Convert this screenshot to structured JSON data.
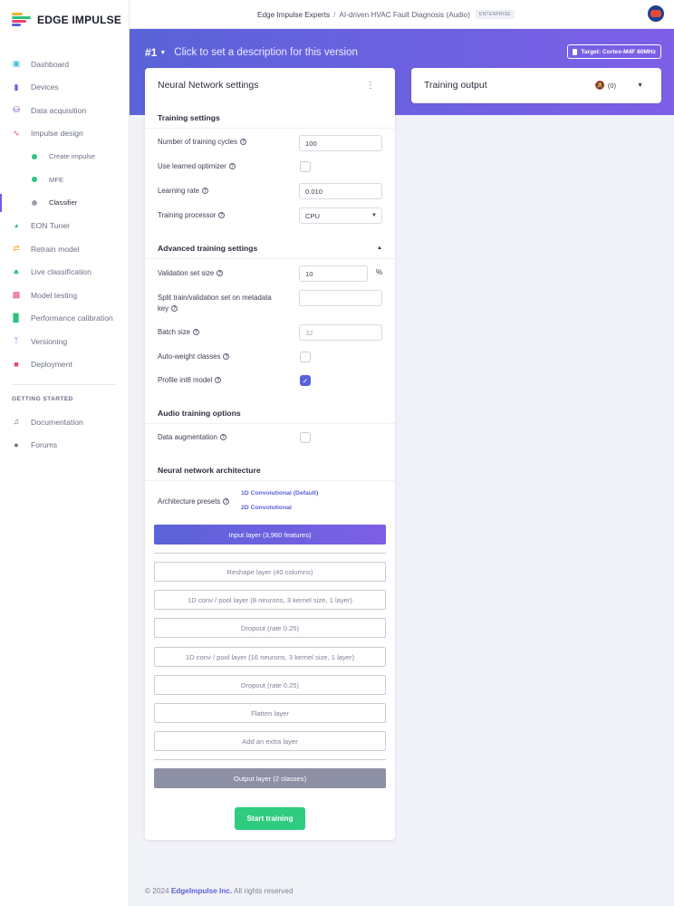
{
  "brand": {
    "name": "EDGE IMPULSE",
    "colors": [
      "#f2b134",
      "#2ec27e",
      "#e4466b",
      "#5b62d9"
    ]
  },
  "sidebar": {
    "items": [
      {
        "label": "Dashboard",
        "icon": "monitor-icon",
        "color": "#3ec0d9"
      },
      {
        "label": "Devices",
        "icon": "device-icon",
        "color": "#6d5ee8"
      },
      {
        "label": "Data acquisition",
        "icon": "database-icon",
        "color": "#7b3fbf"
      },
      {
        "label": "Impulse design",
        "icon": "pulse-icon",
        "color": "#e4466b"
      }
    ],
    "subitems": [
      {
        "label": "Create impulse"
      },
      {
        "label": "MFE"
      },
      {
        "label": "Classifier"
      }
    ],
    "items2": [
      {
        "label": "EON Tuner",
        "icon": "tuner-icon",
        "color": "#2ec27e"
      },
      {
        "label": "Retrain model",
        "icon": "shuffle-icon",
        "color": "#f2b134"
      },
      {
        "label": "Live classification",
        "icon": "live-icon",
        "color": "#2ec27e"
      },
      {
        "label": "Model testing",
        "icon": "testing-icon",
        "color": "#e4466b"
      },
      {
        "label": "Performance calibration",
        "icon": "chart-icon",
        "color": "#2ec27e"
      },
      {
        "label": "Versioning",
        "icon": "branch-icon",
        "color": "#5b62d9"
      },
      {
        "label": "Deployment",
        "icon": "package-icon",
        "color": "#e4466b"
      }
    ],
    "group_label": "GETTING STARTED",
    "help_items": [
      {
        "label": "Documentation",
        "icon": "book-icon"
      },
      {
        "label": "Forums",
        "icon": "chat-icon"
      }
    ]
  },
  "topbar": {
    "org": "Edge Impulse Experts",
    "separator": "/",
    "project": "AI-driven HVAC Fault Diagnosis (Audio)",
    "badge": "ENTERPRISE"
  },
  "banner": {
    "version": "#1",
    "description": "Click to set a description for this version",
    "target": "Target: Cortex-M4F 80MHz"
  },
  "nn_card": {
    "title": "Neural Network settings",
    "training_settings": {
      "heading": "Training settings",
      "cycles_label": "Number of training cycles",
      "cycles_value": "100",
      "optimizer_label": "Use learned optimizer",
      "lr_label": "Learning rate",
      "lr_value": "0.010",
      "processor_label": "Training processor",
      "processor_value": "CPU"
    },
    "advanced": {
      "heading": "Advanced training settings",
      "val_label": "Validation set size",
      "val_value": "10",
      "val_unit": "%",
      "split_label_1": "Split train/validation set on metadata",
      "split_label_2": "key",
      "batch_label": "Batch size",
      "batch_value": "32",
      "autoweight_label": "Auto-weight classes",
      "profile_label": "Profile int8 model"
    },
    "audio": {
      "heading": "Audio training options",
      "aug_label": "Data augmentation"
    },
    "architecture": {
      "heading": "Neural network architecture",
      "presets_label": "Architecture presets",
      "preset_1": "1D Convolutional (Default)",
      "preset_2": "2D Convolutional",
      "input_layer": "Input layer (3,960 features)",
      "layers": [
        "Reshape layer (40 columns)",
        "1D conv / pool layer (8 neurons, 3 kernel size, 1 layer)",
        "Dropout (rate 0.25)",
        "1D conv / pool layer (16 neurons, 3 kernel size, 1 layer)",
        "Dropout (rate 0.25)",
        "Flatten layer",
        "Add an extra layer"
      ],
      "output_layer": "Output layer (2 classes)"
    },
    "start_button": "Start training"
  },
  "training_output": {
    "title": "Training output",
    "count": "(0)"
  },
  "footer": {
    "copyright": "© 2024",
    "company": "EdgeImpulse Inc.",
    "rights": "All rights reserved"
  }
}
